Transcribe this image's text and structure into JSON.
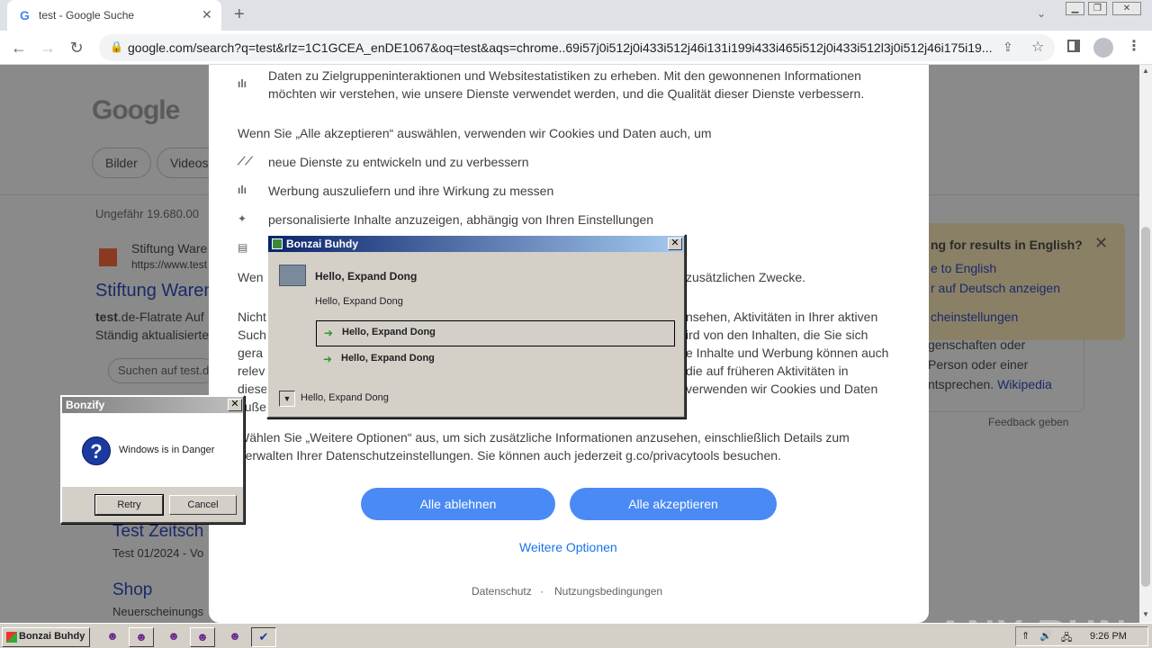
{
  "browser": {
    "tab_title": "test - Google Suche",
    "url": "google.com/search?q=test&rlz=1C1GCEA_enDE1067&oq=test&aqs=chrome..69i57j0i512j0i433i512j46i131i199i433i465i512j0i433i512l3j0i512j46i175i19..."
  },
  "google_results": {
    "logo": "Google",
    "chips": [
      "Bilder",
      "Videos"
    ],
    "result_count": "Ungefähr 19.680.00",
    "result1": {
      "site": "Stiftung Ware",
      "url": "https://www.test",
      "title": "Stiftung Waren",
      "snippet_line1_bold": "test",
      "snippet_line1_rest": ".de-Flatrate Auf",
      "snippet_line2": "Ständig aktualisierte"
    },
    "search_within": "Suchen auf test.d",
    "result2": {
      "title": "Test Zeitsch",
      "snippet": "Test 01/2024 - Vo"
    },
    "result3": {
      "title": "Shop",
      "snippet": "Neuerscheinungs"
    },
    "english_panel": {
      "title": "ng for results in English?",
      "link1": "e to English",
      "link2": "r auf Deutsch anzeigen",
      "link3": "cheinstellungen"
    },
    "knowledge": {
      "line1": "genschaften oder",
      "line2": "Person oder einer",
      "line3_text": "ntsprechen. ",
      "line3_link": "Wikipedia"
    },
    "feedback": "Feedback geben"
  },
  "consent": {
    "intro": "Daten zu Zielgruppeninteraktionen und Websitestatistiken zu erheben. Mit den gewonnenen Informationen möchten wir verstehen, wie unsere Dienste verwendet werden, und die Qualität dieser Dienste verbessern.",
    "accept_heading": "Wenn Sie „Alle akzeptieren“ auswählen, verwenden wir Cookies und Daten auch, um",
    "item1": "neue Dienste zu entwickeln und zu verbessern",
    "item2": "Werbung auszuliefern und ihre Wirkung zu messen",
    "item3": "personalisierte Inhalte anzuzeigen, abhängig von Ihren Einstellungen",
    "wenn_prefix": "Wen",
    "wenn_suffix": "zusätzlichen Zwecke.",
    "para_left": [
      "Nicht",
      "Such",
      "gera",
      "relev",
      "diese",
      "außer"
    ],
    "para_right": [
      "nsehen, Aktivitäten in Ihrer aktiven",
      "ird von den Inhalten, die Sie sich",
      "e Inhalte und Werbung können auch",
      "die auf früheren Aktivitäten in",
      "verwenden wir Cookies und Daten"
    ],
    "more_info": "Wählen Sie „Weitere Optionen“ aus, um sich zusätzliche Informationen anzusehen, einschließlich Details zum Verwalten Ihrer Datenschutzeinstellungen. Sie können auch jederzeit g.co/privacytools besuchen.",
    "reject_label": "Alle ablehnen",
    "accept_label": "Alle akzeptieren",
    "more_options": "Weitere Optionen",
    "privacy": "Datenschutz",
    "separator": "·",
    "terms": "Nutzungsbedingungen"
  },
  "bonzai_dialog": {
    "title": "Bonzai Buhdy",
    "heading": "Hello, Expand Dong",
    "subtext": "Hello, Expand Dong",
    "option1": "Hello, Expand Dong",
    "option2": "Hello, Expand Dong",
    "checkbox_label": "Hello, Expand Dong"
  },
  "bonzify_dialog": {
    "title": "Bonzify",
    "message": "Windows is in Danger",
    "retry": "Retry",
    "cancel": "Cancel"
  },
  "taskbar": {
    "start_label": "Bonzai Buhdy",
    "clock": "9:26 PM"
  },
  "watermark": "ANY RUN"
}
